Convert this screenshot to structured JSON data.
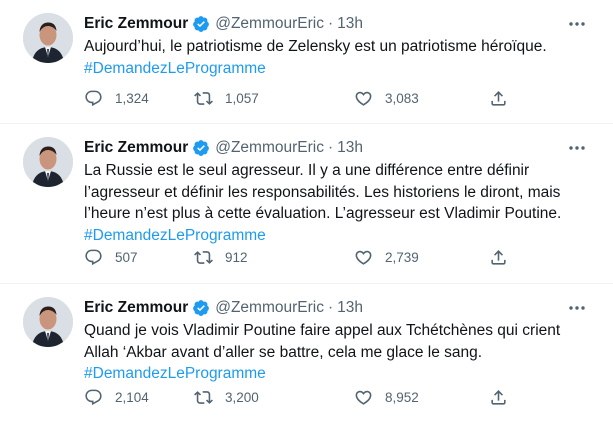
{
  "tweets": [
    {
      "author": "Eric Zemmour",
      "handle": "@ZemmourEric",
      "dot": "·",
      "time": "13h",
      "text": "Aujourd’hui, le patriotisme de Zelensky est un patriotisme héroïque.",
      "hashtag": "#DemandezLeProgramme",
      "replies": "1,324",
      "retweets": "1,057",
      "likes": "3,083"
    },
    {
      "author": "Eric Zemmour",
      "handle": "@ZemmourEric",
      "dot": "·",
      "time": "13h",
      "text": "La Russie est le seul agresseur. Il y a une différence entre définir l’agresseur et définir les responsabilités. Les historiens le diront, mais l’heure n’est plus à cette évaluation. L’agresseur est Vladimir Poutine.",
      "hashtag": "#DemandezLeProgramme",
      "replies": "507",
      "retweets": "912",
      "likes": "2,739"
    },
    {
      "author": "Eric Zemmour",
      "handle": "@ZemmourEric",
      "dot": "·",
      "time": "13h",
      "text": "Quand je vois Vladimir Poutine faire appel aux Tchétchènes qui crient Allah ‘Akbar avant d’aller se battre, cela me glace le sang.",
      "hashtag": "#DemandezLeProgramme",
      "replies": "2,104",
      "retweets": "3,200",
      "likes": "8,952"
    }
  ],
  "icons": {
    "verified": "verified-badge-icon",
    "more": "more-options-icon",
    "reply": "reply-icon",
    "retweet": "retweet-icon",
    "like": "heart-icon",
    "share": "share-icon"
  },
  "colors": {
    "text": "#0f1419",
    "secondary": "#536471",
    "accent": "#1d9bf0",
    "divider": "#eff3f4"
  }
}
